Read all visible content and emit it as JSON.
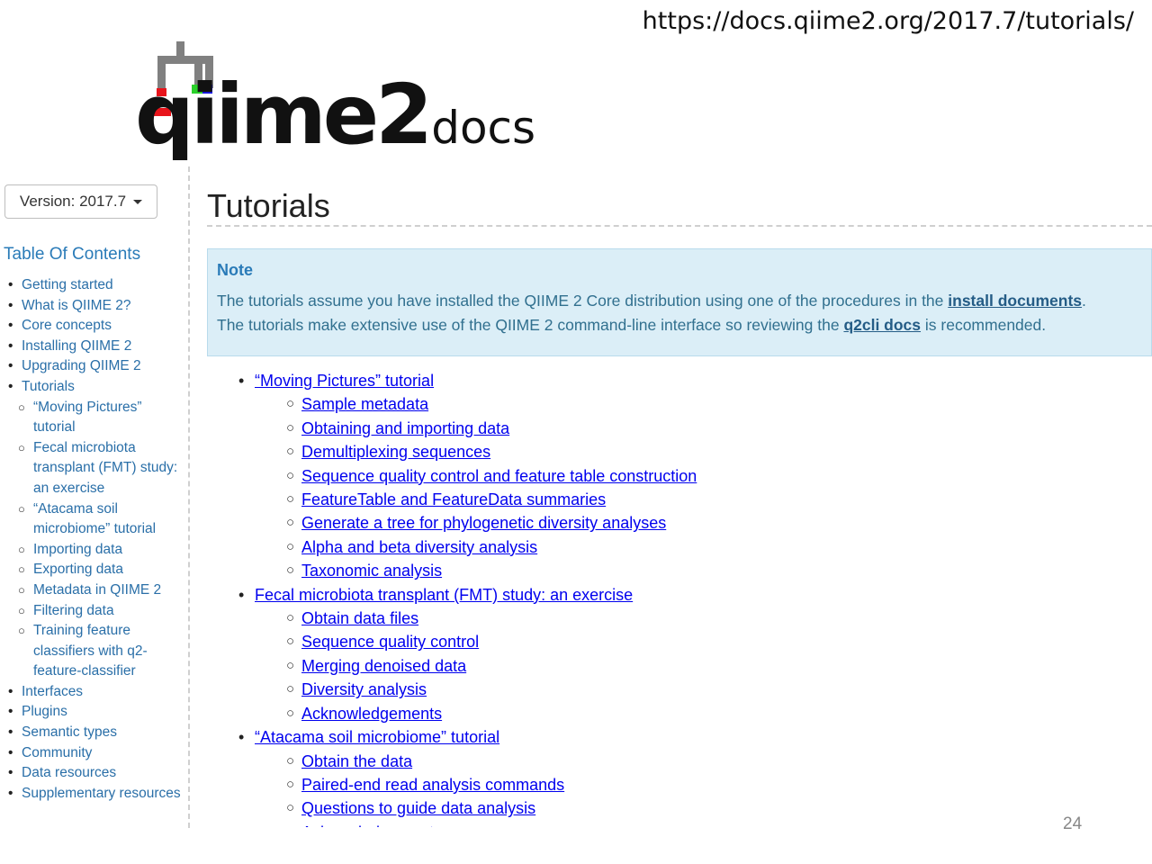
{
  "url": "https://docs.qiime2.org/2017.7/tutorials/",
  "logo": {
    "main": "qiime2",
    "suffix": "docs"
  },
  "sidebar": {
    "version_label": "Version: 2017.7",
    "toc_title": "Table Of Contents",
    "items": [
      {
        "level": 1,
        "label": "Getting started"
      },
      {
        "level": 1,
        "label": "What is QIIME 2?"
      },
      {
        "level": 1,
        "label": "Core concepts"
      },
      {
        "level": 1,
        "label": "Installing QIIME 2"
      },
      {
        "level": 1,
        "label": "Upgrading QIIME 2"
      },
      {
        "level": 1,
        "label": "Tutorials"
      },
      {
        "level": 2,
        "label": "“Moving Pictures” tutorial"
      },
      {
        "level": 2,
        "label": "Fecal microbiota transplant (FMT) study: an exercise"
      },
      {
        "level": 2,
        "label": "“Atacama soil microbiome” tutorial"
      },
      {
        "level": 2,
        "label": "Importing data"
      },
      {
        "level": 2,
        "label": "Exporting data"
      },
      {
        "level": 2,
        "label": "Metadata in QIIME 2"
      },
      {
        "level": 2,
        "label": "Filtering data"
      },
      {
        "level": 2,
        "label": "Training feature classifiers with q2-feature-classifier"
      },
      {
        "level": 1,
        "label": "Interfaces"
      },
      {
        "level": 1,
        "label": "Plugins"
      },
      {
        "level": 1,
        "label": "Semantic types"
      },
      {
        "level": 1,
        "label": "Community"
      },
      {
        "level": 1,
        "label": "Data resources"
      },
      {
        "level": 1,
        "label": "Supplementary resources"
      }
    ]
  },
  "main": {
    "title": "Tutorials",
    "note": {
      "title": "Note",
      "line1_pre": "The tutorials assume you have installed the QIIME 2 Core distribution using one of the procedures in the ",
      "line1_link": "install documents",
      "line1_post": ".",
      "line2_pre": "The tutorials make extensive use of the QIIME 2 command-line interface so reviewing the ",
      "line2_link": "q2cli docs",
      "line2_post": " is recommended."
    },
    "items": [
      {
        "level": 1,
        "label": "“Moving Pictures” tutorial"
      },
      {
        "level": 2,
        "label": "Sample metadata"
      },
      {
        "level": 2,
        "label": "Obtaining and importing data"
      },
      {
        "level": 2,
        "label": "Demultiplexing sequences"
      },
      {
        "level": 2,
        "label": "Sequence quality control and feature table construction"
      },
      {
        "level": 2,
        "label": "FeatureTable and FeatureData summaries"
      },
      {
        "level": 2,
        "label": "Generate a tree for phylogenetic diversity analyses"
      },
      {
        "level": 2,
        "label": "Alpha and beta diversity analysis"
      },
      {
        "level": 2,
        "label": "Taxonomic analysis"
      },
      {
        "level": 1,
        "label": "Fecal microbiota transplant (FMT) study: an exercise"
      },
      {
        "level": 2,
        "label": "Obtain data files"
      },
      {
        "level": 2,
        "label": "Sequence quality control"
      },
      {
        "level": 2,
        "label": "Merging denoised data"
      },
      {
        "level": 2,
        "label": "Diversity analysis"
      },
      {
        "level": 2,
        "label": "Acknowledgements"
      },
      {
        "level": 1,
        "label": "“Atacama soil microbiome” tutorial"
      },
      {
        "level": 2,
        "label": "Obtain the data"
      },
      {
        "level": 2,
        "label": "Paired-end read analysis commands"
      },
      {
        "level": 2,
        "label": "Questions to guide data analysis"
      },
      {
        "level": 2,
        "label": "Acknowledgements"
      }
    ]
  },
  "page_number": "24",
  "colors": {
    "link": "#2a6fa8",
    "note_bg": "#dbeef7",
    "note_title": "#2a7bb8"
  },
  "logo_colors": {
    "tree": "#808080",
    "red": "#e8141b",
    "green": "#2bd12b",
    "blue": "#1717e6"
  }
}
